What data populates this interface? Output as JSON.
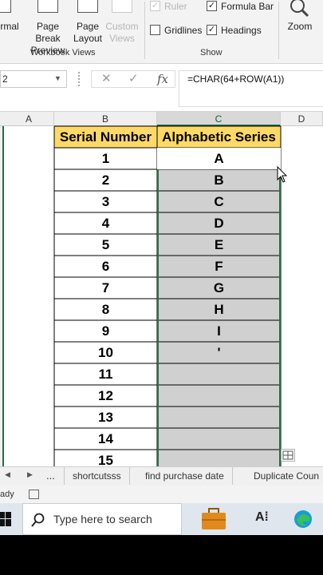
{
  "ribbon": {
    "buttons": {
      "normal": "rmal",
      "page_break_preview": [
        "Page Break",
        "Preview"
      ],
      "page_layout": [
        "Page",
        "Layout"
      ],
      "custom_views": [
        "Custom",
        "Views"
      ],
      "zoom": "Zoom"
    },
    "groups": {
      "workbook_views": "Workbook Views",
      "show": "Show"
    },
    "checkboxes": {
      "ruler": {
        "label": "Ruler",
        "checked": true,
        "disabled": true
      },
      "formula_bar": {
        "label": "Formula Bar",
        "checked": true
      },
      "gridlines": {
        "label": "Gridlines",
        "checked": false
      },
      "headings": {
        "label": "Headings",
        "checked": true
      }
    }
  },
  "formula_bar": {
    "name_box": "2",
    "cancel_glyph": "✕",
    "enter_glyph": "✓",
    "fx_glyph": "fx",
    "formula": "=CHAR(64+ROW(A1))"
  },
  "grid": {
    "columns": [
      "A",
      "B",
      "C",
      "D"
    ],
    "selected_column": "C",
    "header_row": [
      "Serial Number",
      "Alphabetic Series"
    ],
    "rows": [
      [
        "1",
        "A"
      ],
      [
        "2",
        "B"
      ],
      [
        "3",
        "C"
      ],
      [
        "4",
        "D"
      ],
      [
        "5",
        "E"
      ],
      [
        "6",
        "F"
      ],
      [
        "7",
        "G"
      ],
      [
        "8",
        "H"
      ],
      [
        "9",
        "I"
      ],
      [
        "10",
        "'"
      ],
      [
        "11",
        ""
      ],
      [
        "12",
        ""
      ],
      [
        "13",
        ""
      ],
      [
        "14",
        ""
      ],
      [
        "15",
        ""
      ]
    ]
  },
  "sheet_tabs": {
    "more": "...",
    "tabs": [
      "shortcutsss",
      "find purchase date",
      "Duplicate Coun"
    ]
  },
  "status_bar": {
    "text": "ady"
  },
  "taskbar": {
    "search_placeholder": "Type here to search",
    "ai_label": "A⁞"
  },
  "colors": {
    "header_fill": "#ffd966",
    "selection_fill": "#d0d0d0",
    "selection_border": "#217346",
    "sheet_border": "#1f7145"
  }
}
